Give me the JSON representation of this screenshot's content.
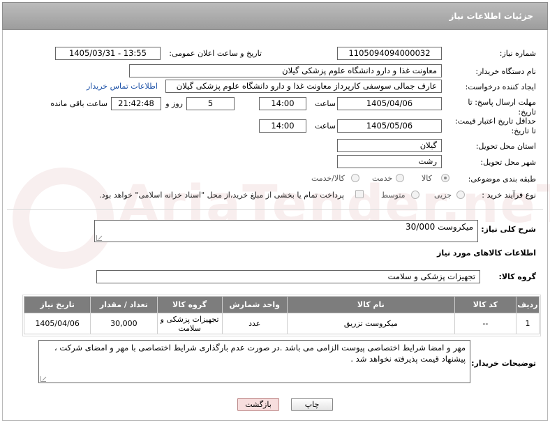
{
  "header": {
    "title": "جزئیات اطلاعات نیاز"
  },
  "form": {
    "need_number_label": "شماره نیاز:",
    "need_number": "1105094094000032",
    "announce_label": "تاریخ و ساعت اعلان عمومی:",
    "announce_value": "1405/03/31 - 13:55",
    "buyer_org_label": "نام دستگاه خریدار:",
    "buyer_org": "معاونت غذا و دارو دانشگاه علوم پزشکی گیلان",
    "creator_label": "ایجاد کننده درخواست:",
    "creator": "عارف جمالی سوسفی کارپرداز معاونت غذا و دارو دانشگاه علوم پزشکی گیلان",
    "contact_link": "اطلاعات تماس خریدار",
    "reply_deadline_label": "مهلت ارسال پاسخ: تا تاریخ:",
    "reply_date": "1405/04/06",
    "time_label": "ساعت",
    "reply_time": "14:00",
    "days_value": "5",
    "days_label": "روز و",
    "remaining_value": "21:42:48",
    "remaining_label": "ساعت باقی مانده",
    "price_deadline_label": "حداقل تاریخ اعتبار قیمت: تا تاریخ:",
    "price_date": "1405/05/06",
    "price_time": "14:00",
    "province_label": "استان محل تحویل:",
    "province": "گیلان",
    "city_label": "شهر محل تحویل:",
    "city": "رشت",
    "category_label": "طبقه بندی موضوعی:",
    "category_options": [
      "کالا",
      "خدمت",
      "کالا/خدمت"
    ],
    "category_selected": "کالا",
    "purchase_type_label": "نوع فرآیند خرید :",
    "purchase_options": [
      "جزیی",
      "متوسط"
    ],
    "payment_note": "پرداخت تمام یا بخشی از مبلغ خرید،از محل \"اسناد خزانه اسلامی\" خواهد بود."
  },
  "description": {
    "label": "شرح کلی نیاز:",
    "value": "میکروست 30/000"
  },
  "goods": {
    "section_title": "اطلاعات کالاهای مورد نیاز",
    "group_label": "گروه کالا:",
    "group_value": "تجهیزات پزشکی و سلامت",
    "columns": [
      "ردیف",
      "کد کالا",
      "نام کالا",
      "واحد شمارش",
      "گروه کالا",
      "تعداد / مقدار",
      "تاریخ نیاز"
    ],
    "rows": [
      {
        "row": "1",
        "code": "--",
        "name": "میکروست تزریق",
        "unit": "عدد",
        "group": "تجهیزات پزشکی و سلامت",
        "qty": "30,000",
        "date": "1405/04/06"
      }
    ]
  },
  "buyer_notes": {
    "label": "توضیحات خریدار:",
    "value": "مهر و امضا شرایط اختصاصی پیوست الزامی می باشد .در صورت عدم بارگذاری شرایط اختصاصی با مهر و امضای شرکت ، پیشنهاد قیمت پذیرفته نخواهد شد ."
  },
  "buttons": {
    "print": "چاپ",
    "back": "بازگشت"
  },
  "watermark": "AriaTender.neT",
  "colors": {
    "header_bg": "#a8a8a8",
    "table_header": "#7d7d7d",
    "link": "#1a4fa6",
    "back_button": "#f7dede"
  }
}
